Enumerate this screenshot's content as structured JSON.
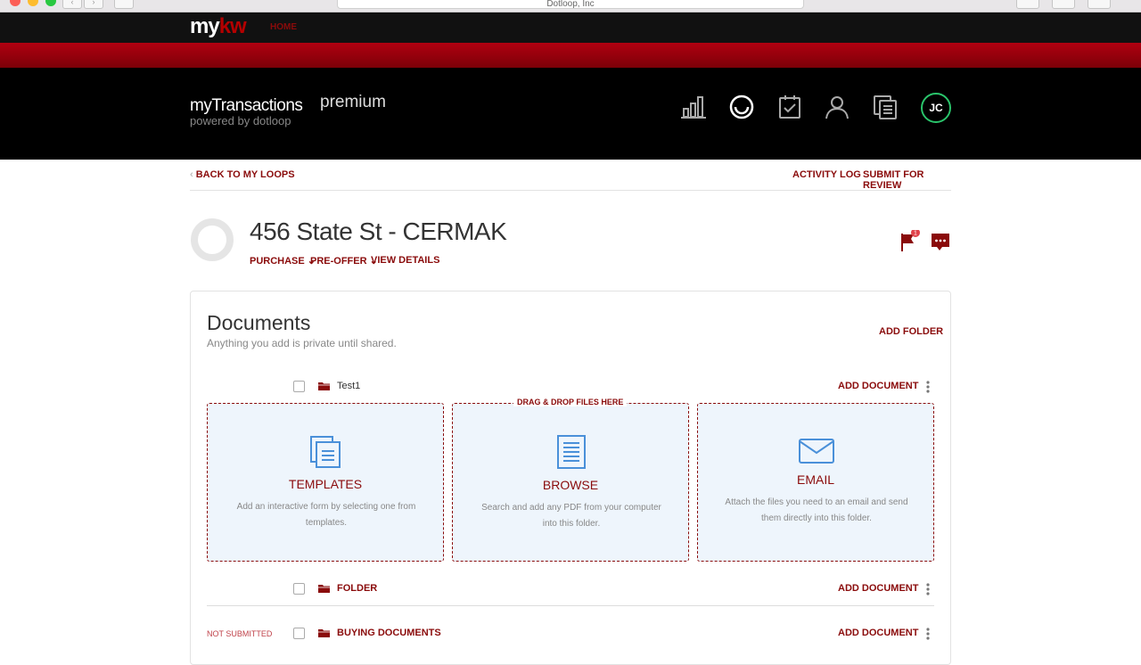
{
  "browser": {
    "url": "Dotloop, Inc"
  },
  "mykw": {
    "logo_my": "my",
    "logo_kw": "kw",
    "home_label": "HOME"
  },
  "header": {
    "brand": "myTransactions",
    "tier": "premium",
    "powered_by": "powered by dotloop",
    "icons": [
      "bar-chart-icon",
      "loop-icon",
      "checklist-icon",
      "person-icon",
      "documents-icon"
    ],
    "avatar_initials": "JC"
  },
  "subnav": {
    "back_label": "BACK TO MY LOOPS",
    "activity_label": "ACTIVITY LOG",
    "submit_label": "SUBMIT FOR REVIEW"
  },
  "loop": {
    "title": "456 State St - CERMAK",
    "type_label": "PURCHASE",
    "status_label": "PRE-OFFER",
    "details_label": "VIEW DETAILS",
    "flag_count": "1"
  },
  "documents": {
    "title": "Documents",
    "subtitle": "Anything you add is private until shared.",
    "add_folder_label": "ADD FOLDER",
    "folders": [
      {
        "name": "Test1",
        "add_label": "ADD DOCUMENT",
        "status": ""
      },
      {
        "name": "FOLDER",
        "add_label": "ADD DOCUMENT",
        "status": ""
      },
      {
        "name": "BUYING DOCUMENTS",
        "add_label": "ADD DOCUMENT",
        "status": "NOT SUBMITTED"
      }
    ],
    "drag_label": "DRAG & DROP FILES HERE",
    "options": [
      {
        "title": "TEMPLATES",
        "desc": "Add an interactive form by selecting one from templates."
      },
      {
        "title": "BROWSE",
        "desc": "Search and add any PDF from your computer into this folder."
      },
      {
        "title": "EMAIL",
        "desc": "Attach the files you need to an email and send them directly into this folder."
      }
    ]
  },
  "colors": {
    "accent": "#8a0b0b",
    "red_bar": "#a0000e",
    "avatar_ring": "#2ac46b",
    "drop_bg": "#eef5fc"
  }
}
